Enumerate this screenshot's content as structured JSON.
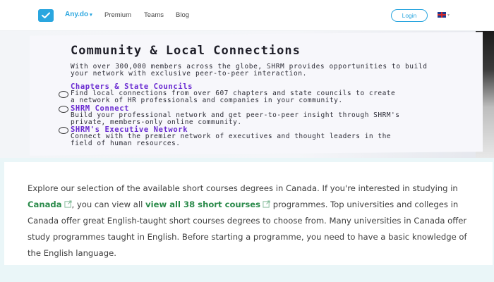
{
  "nav": {
    "brand": "Any.do",
    "links": [
      "Premium",
      "Teams",
      "Blog"
    ],
    "login": "Login"
  },
  "hero": {
    "title": "Community & Local Connections",
    "intro": "With over 300,000 members across the globe, SHRM provides opportunities to build your network with exclusive peer-to-peer interaction.",
    "items": [
      {
        "title": "Chapters & State Councils",
        "desc": "Find local connections from over 607 chapters and state councils to create a network of HR professionals and companies in your community."
      },
      {
        "title": "SHRM Connect",
        "desc": "Build your professional network and get peer-to-peer insight through SHRM's private, members-only online community."
      },
      {
        "title": "SHRM's Executive Network",
        "desc": "Connect with the premier network of executives and thought leaders in the field of human resources."
      }
    ]
  },
  "article": {
    "p1": "Explore our selection of the available short courses degrees in Canada. If you're interested in studying in ",
    "link1": "Canada",
    "p2": ", you can view all ",
    "link2": "view all 38 short courses",
    "p3": " programmes. Top universities and colleges in Canada offer great English-taught short courses degrees to choose from. Many universities in Canada offer study programmes taught in English. Before starting a programme, you need to have a basic knowledge of the English language."
  },
  "colors": {
    "brand": "#2aa6df",
    "link": "#2a8a4a",
    "accent_purple": "#6a2bd1"
  }
}
